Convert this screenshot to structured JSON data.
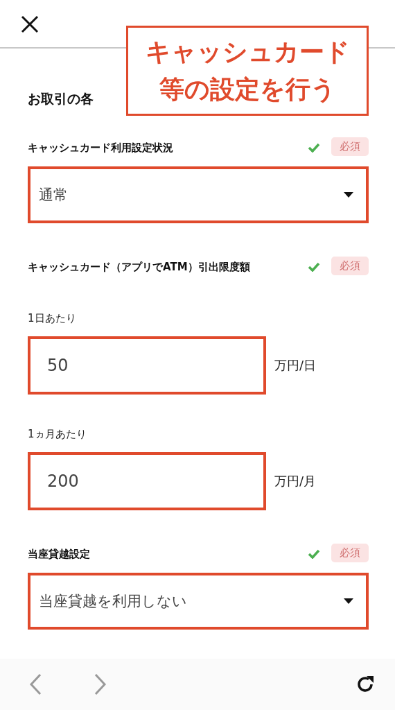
{
  "callout": {
    "lines": [
      "キャッシュカード",
      "等の設定を行う"
    ]
  },
  "heading": "お取引の各",
  "sections": [
    {
      "kind": "select",
      "label": "キャッシュカード利用設定状況",
      "valid": true,
      "required_badge": "必須",
      "value": "通常"
    },
    {
      "kind": "group",
      "label": "キャッシュカード（アプリでATM）引出限度額",
      "valid": true,
      "required_badge": "必須"
    },
    {
      "kind": "input",
      "label": "1日あたり",
      "value": "50",
      "unit": "万円/日"
    },
    {
      "kind": "input",
      "label": "1ヵ月あたり",
      "value": "200",
      "unit": "万円/月"
    },
    {
      "kind": "select",
      "label": "当座貸越設定",
      "valid": true,
      "required_badge": "必須",
      "value": "当座貸越を利用しない"
    }
  ],
  "toolbar": {
    "back_disabled": true,
    "forward_disabled": true
  }
}
